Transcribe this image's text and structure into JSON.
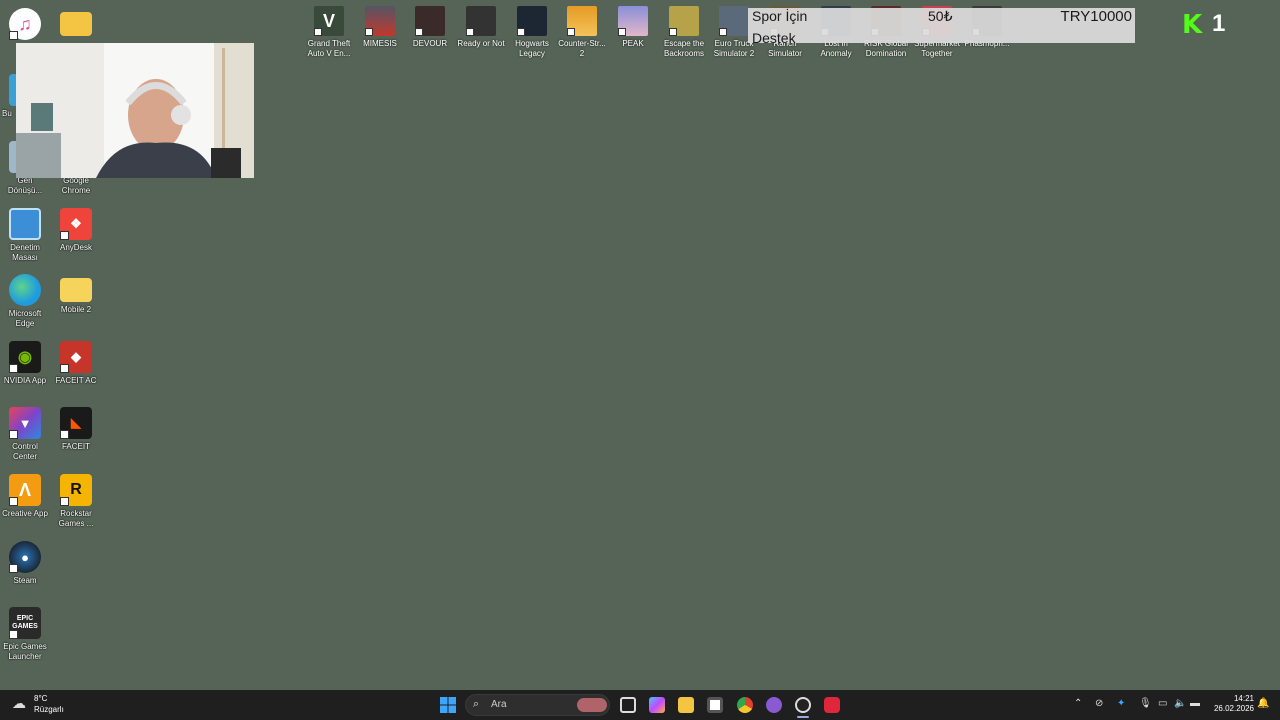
{
  "desktop_left": [
    {
      "label": "",
      "icon": "itunes-icon",
      "color": "#e44f8f"
    },
    {
      "label": "",
      "icon": "folder-icon",
      "color": "#f4c542"
    },
    {
      "label": "Bu",
      "icon": "this-pc-icon",
      "color": "#3aa0d8"
    },
    {
      "label": "Geri Dönüşü...",
      "icon": "recycle-bin-icon",
      "color": "#9fb7c9"
    },
    {
      "label": "Google Chrome",
      "icon": "chrome-icon",
      "color": "#e1412d"
    },
    {
      "label": "Denetim Masası",
      "icon": "control-panel-icon",
      "color": "#3c8fd6"
    },
    {
      "label": "AnyDesk",
      "icon": "anydesk-icon",
      "color": "#ef443b"
    },
    {
      "label": "Microsoft Edge",
      "icon": "edge-icon",
      "color": "#1f9be0"
    },
    {
      "label": "Mobile 2",
      "icon": "folder-icon",
      "color": "#f6d35a"
    },
    {
      "label": "NVIDIA App",
      "icon": "nvidia-icon",
      "color": "#76b900"
    },
    {
      "label": "FACEIT AC",
      "icon": "faceit-ac-icon",
      "color": "#c7352a"
    },
    {
      "label": "Control Center",
      "icon": "control-center-icon",
      "color": "#7e44c7"
    },
    {
      "label": "FACEIT",
      "icon": "faceit-icon",
      "color": "#1a1a1a"
    },
    {
      "label": "Creative App",
      "icon": "creative-app-icon",
      "color": "#f39c12"
    },
    {
      "label": "Rockstar Games ...",
      "icon": "rockstar-icon",
      "color": "#f5b400"
    },
    {
      "label": "Steam",
      "icon": "steam-icon",
      "color": "#1b2838"
    },
    {
      "label": "Epic Games Launcher",
      "icon": "epic-games-icon",
      "color": "#2a2a2a"
    }
  ],
  "desktop_top": [
    {
      "label": "Grand Theft Auto V En...",
      "icon": "gta-v-icon",
      "color": "#3a4a3a"
    },
    {
      "label": "MIMESIS",
      "icon": "mimesis-icon",
      "color": "#c0392b"
    },
    {
      "label": "DEVOUR",
      "icon": "devour-icon",
      "color": "#3b2a2a"
    },
    {
      "label": "Ready or Not",
      "icon": "ready-or-not-icon",
      "color": "#333333"
    },
    {
      "label": "Hogwarts Legacy",
      "icon": "hogwarts-legacy-icon",
      "color": "#1d2733"
    },
    {
      "label": "Counter-Str... 2",
      "icon": "counter-strike-icon",
      "color": "#e69b24"
    },
    {
      "label": "PEAK",
      "icon": "peak-icon",
      "color": "#8a8fd8"
    },
    {
      "label": "Escape the Backrooms",
      "icon": "escape-backrooms-icon",
      "color": "#b6a248"
    },
    {
      "label": "Euro Truck Simulator 2",
      "icon": "euro-truck-icon",
      "color": "#5a6a7a"
    },
    {
      "label": "Ranch Simulator",
      "icon": "ranch-simulator-icon",
      "color": "#6b5a3a"
    },
    {
      "label": "Lost in Anomaly",
      "icon": "lost-in-anomaly-icon",
      "color": "#2d3d4d"
    },
    {
      "label": "RISK Global Domination",
      "icon": "risk-icon",
      "color": "#5a2a2a"
    },
    {
      "label": "Supermarket Together",
      "icon": "supermarket-icon",
      "color": "#c94050"
    },
    {
      "label": "Phasmoph...",
      "icon": "phasmophobia-icon",
      "color": "#3a3a3a"
    }
  ],
  "donation": {
    "line1": "Spor İçin",
    "line2": "Destek",
    "amount": "50₺",
    "total": "TRY10000"
  },
  "kick": {
    "logo": "K",
    "count": "1"
  },
  "taskbar": {
    "weather_temp": "8°C",
    "weather_desc": "Rüzgarlı",
    "search_placeholder": "Ara",
    "time": "14:21",
    "date": "26.02.2026"
  },
  "colors": {
    "desktop_bg": "#566457",
    "taskbar_bg": "#1f1f1f",
    "kick_green": "#53fc18"
  }
}
